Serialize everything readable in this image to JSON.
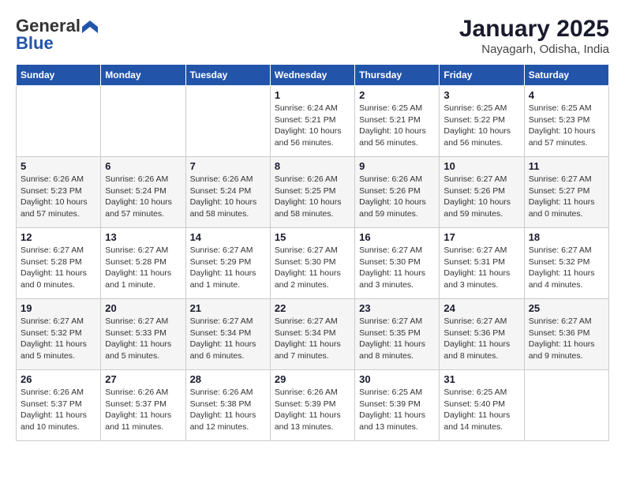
{
  "header": {
    "logo_general": "General",
    "logo_blue": "Blue",
    "title": "January 2025",
    "subtitle": "Nayagarh, Odisha, India"
  },
  "days_of_week": [
    "Sunday",
    "Monday",
    "Tuesday",
    "Wednesday",
    "Thursday",
    "Friday",
    "Saturday"
  ],
  "weeks": [
    [
      {
        "day": "",
        "info": ""
      },
      {
        "day": "",
        "info": ""
      },
      {
        "day": "",
        "info": ""
      },
      {
        "day": "1",
        "info": "Sunrise: 6:24 AM\nSunset: 5:21 PM\nDaylight: 10 hours\nand 56 minutes."
      },
      {
        "day": "2",
        "info": "Sunrise: 6:25 AM\nSunset: 5:21 PM\nDaylight: 10 hours\nand 56 minutes."
      },
      {
        "day": "3",
        "info": "Sunrise: 6:25 AM\nSunset: 5:22 PM\nDaylight: 10 hours\nand 56 minutes."
      },
      {
        "day": "4",
        "info": "Sunrise: 6:25 AM\nSunset: 5:23 PM\nDaylight: 10 hours\nand 57 minutes."
      }
    ],
    [
      {
        "day": "5",
        "info": "Sunrise: 6:26 AM\nSunset: 5:23 PM\nDaylight: 10 hours\nand 57 minutes."
      },
      {
        "day": "6",
        "info": "Sunrise: 6:26 AM\nSunset: 5:24 PM\nDaylight: 10 hours\nand 57 minutes."
      },
      {
        "day": "7",
        "info": "Sunrise: 6:26 AM\nSunset: 5:24 PM\nDaylight: 10 hours\nand 58 minutes."
      },
      {
        "day": "8",
        "info": "Sunrise: 6:26 AM\nSunset: 5:25 PM\nDaylight: 10 hours\nand 58 minutes."
      },
      {
        "day": "9",
        "info": "Sunrise: 6:26 AM\nSunset: 5:26 PM\nDaylight: 10 hours\nand 59 minutes."
      },
      {
        "day": "10",
        "info": "Sunrise: 6:27 AM\nSunset: 5:26 PM\nDaylight: 10 hours\nand 59 minutes."
      },
      {
        "day": "11",
        "info": "Sunrise: 6:27 AM\nSunset: 5:27 PM\nDaylight: 11 hours\nand 0 minutes."
      }
    ],
    [
      {
        "day": "12",
        "info": "Sunrise: 6:27 AM\nSunset: 5:28 PM\nDaylight: 11 hours\nand 0 minutes."
      },
      {
        "day": "13",
        "info": "Sunrise: 6:27 AM\nSunset: 5:28 PM\nDaylight: 11 hours\nand 1 minute."
      },
      {
        "day": "14",
        "info": "Sunrise: 6:27 AM\nSunset: 5:29 PM\nDaylight: 11 hours\nand 1 minute."
      },
      {
        "day": "15",
        "info": "Sunrise: 6:27 AM\nSunset: 5:30 PM\nDaylight: 11 hours\nand 2 minutes."
      },
      {
        "day": "16",
        "info": "Sunrise: 6:27 AM\nSunset: 5:30 PM\nDaylight: 11 hours\nand 3 minutes."
      },
      {
        "day": "17",
        "info": "Sunrise: 6:27 AM\nSunset: 5:31 PM\nDaylight: 11 hours\nand 3 minutes."
      },
      {
        "day": "18",
        "info": "Sunrise: 6:27 AM\nSunset: 5:32 PM\nDaylight: 11 hours\nand 4 minutes."
      }
    ],
    [
      {
        "day": "19",
        "info": "Sunrise: 6:27 AM\nSunset: 5:32 PM\nDaylight: 11 hours\nand 5 minutes."
      },
      {
        "day": "20",
        "info": "Sunrise: 6:27 AM\nSunset: 5:33 PM\nDaylight: 11 hours\nand 5 minutes."
      },
      {
        "day": "21",
        "info": "Sunrise: 6:27 AM\nSunset: 5:34 PM\nDaylight: 11 hours\nand 6 minutes."
      },
      {
        "day": "22",
        "info": "Sunrise: 6:27 AM\nSunset: 5:34 PM\nDaylight: 11 hours\nand 7 minutes."
      },
      {
        "day": "23",
        "info": "Sunrise: 6:27 AM\nSunset: 5:35 PM\nDaylight: 11 hours\nand 8 minutes."
      },
      {
        "day": "24",
        "info": "Sunrise: 6:27 AM\nSunset: 5:36 PM\nDaylight: 11 hours\nand 8 minutes."
      },
      {
        "day": "25",
        "info": "Sunrise: 6:27 AM\nSunset: 5:36 PM\nDaylight: 11 hours\nand 9 minutes."
      }
    ],
    [
      {
        "day": "26",
        "info": "Sunrise: 6:26 AM\nSunset: 5:37 PM\nDaylight: 11 hours\nand 10 minutes."
      },
      {
        "day": "27",
        "info": "Sunrise: 6:26 AM\nSunset: 5:37 PM\nDaylight: 11 hours\nand 11 minutes."
      },
      {
        "day": "28",
        "info": "Sunrise: 6:26 AM\nSunset: 5:38 PM\nDaylight: 11 hours\nand 12 minutes."
      },
      {
        "day": "29",
        "info": "Sunrise: 6:26 AM\nSunset: 5:39 PM\nDaylight: 11 hours\nand 13 minutes."
      },
      {
        "day": "30",
        "info": "Sunrise: 6:25 AM\nSunset: 5:39 PM\nDaylight: 11 hours\nand 13 minutes."
      },
      {
        "day": "31",
        "info": "Sunrise: 6:25 AM\nSunset: 5:40 PM\nDaylight: 11 hours\nand 14 minutes."
      },
      {
        "day": "",
        "info": ""
      }
    ]
  ]
}
